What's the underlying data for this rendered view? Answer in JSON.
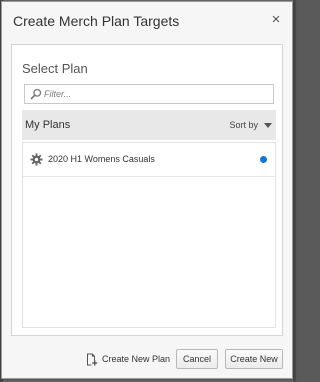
{
  "dialog": {
    "title": "Create Merch Plan Targets",
    "close_icon": "close-icon",
    "close_glyph": "×"
  },
  "select_plan": {
    "title": "Select Plan",
    "filter": {
      "placeholder": "Filter...",
      "value": "",
      "icon": "search-icon"
    },
    "list_header": {
      "title": "My Plans",
      "sort_label": "Sort by",
      "sort_icon": "caret-down-icon"
    },
    "plans": [
      {
        "name": "2020 H1 Womens Casuals",
        "icon": "gear-icon",
        "status_color": "#1a73d9"
      }
    ]
  },
  "footer": {
    "create_new_plan_label": "Create New Plan",
    "create_new_plan_icon": "new-document-icon",
    "cancel_label": "Cancel",
    "create_new_label": "Create New"
  }
}
